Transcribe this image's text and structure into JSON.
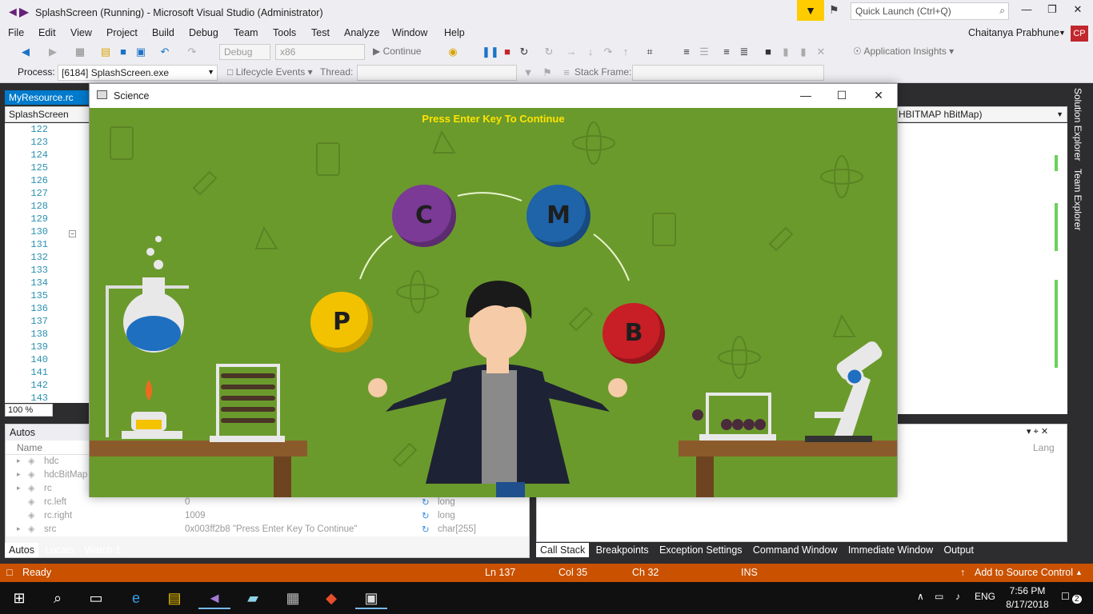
{
  "titlebar": {
    "title": "SplashScreen (Running) - Microsoft Visual Studio  (Administrator)",
    "quick_launch_placeholder": "Quick Launch (Ctrl+Q)"
  },
  "menu": [
    "File",
    "Edit",
    "View",
    "Project",
    "Build",
    "Debug",
    "Team",
    "Tools",
    "Test",
    "Analyze",
    "Window",
    "Help"
  ],
  "user": {
    "name": "Chaitanya Prabhune",
    "initials": "CP"
  },
  "toolbar1": {
    "config": "Debug",
    "platform": "x86",
    "continue_label": "Continue",
    "app_insights": "Application Insights"
  },
  "toolbar2": {
    "process_label": "Process:",
    "process_value": "[6184] SplashScreen.exe",
    "lifecycle": "Lifecycle Events",
    "thread_label": "Thread:",
    "stack_frame_label": "Stack Frame:"
  },
  "editor": {
    "tab": "MyResource.rc",
    "nav_left": "SplashScreen",
    "nav_right": "HBITMAP hBitMap)",
    "line_numbers": [
      "122",
      "123",
      "124",
      "125",
      "126",
      "127",
      "128",
      "129",
      "130",
      "131",
      "132",
      "133",
      "134",
      "135",
      "136",
      "137",
      "138",
      "139",
      "140",
      "141",
      "142",
      "143"
    ],
    "zoom": "100 %"
  },
  "side_tabs": [
    "Solution Explorer",
    "Team Explorer"
  ],
  "autos": {
    "title": "Autos",
    "column_name": "Name",
    "column_lang": "Lang",
    "rows": [
      {
        "name": "hdc",
        "value": "",
        "type": ""
      },
      {
        "name": "hdcBitMap",
        "value": "",
        "type": ""
      },
      {
        "name": "rc",
        "value": "",
        "type": ""
      },
      {
        "name": "rc.left",
        "value": "0",
        "type": "long"
      },
      {
        "name": "rc.right",
        "value": "1009",
        "type": "long"
      },
      {
        "name": "src",
        "value": "0x003ff2b8 \"Press Enter Key To Continue\"",
        "type": "char[255]"
      }
    ],
    "tabs": [
      "Autos",
      "Locals",
      "Watch 1"
    ]
  },
  "bottom_tabs": [
    "Call Stack",
    "Breakpoints",
    "Exception Settings",
    "Command Window",
    "Immediate Window",
    "Output"
  ],
  "status": {
    "state": "Ready",
    "ln": "Ln 137",
    "col": "Col 35",
    "ch": "Ch 32",
    "ins": "INS",
    "source_control": "Add to Source Control"
  },
  "science_window": {
    "title": "Science",
    "prompt": "Press Enter Key To Continue",
    "balls": [
      {
        "letter": "C",
        "color": "#7b3a96"
      },
      {
        "letter": "M",
        "color": "#1f63a8"
      },
      {
        "letter": "P",
        "color": "#f2c200"
      },
      {
        "letter": "B",
        "color": "#c81e26"
      }
    ]
  },
  "taskbar": {
    "time": "7:56 PM",
    "date": "8/17/2018",
    "lang": "ENG",
    "notifications": "2"
  }
}
